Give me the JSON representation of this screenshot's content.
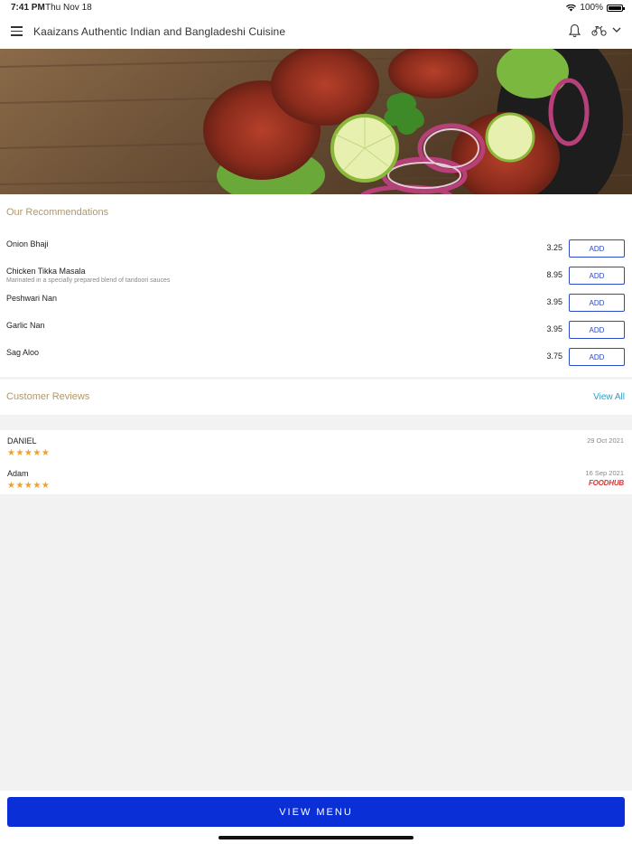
{
  "status_bar": {
    "time": "7:41 PM",
    "date": "Thu Nov 18",
    "battery": "100%"
  },
  "header": {
    "title": "Kaaizans Authentic Indian and Bangladeshi Cuisine"
  },
  "recommendations": {
    "title": "Our Recommendations",
    "items": [
      {
        "name": "Onion Bhaji",
        "description": "",
        "price": "3.25",
        "add_label": "ADD"
      },
      {
        "name": "Chicken Tikka Masala",
        "description": "Marinated in a specially prepared blend of tandoori sauces",
        "price": "8.95",
        "add_label": "ADD"
      },
      {
        "name": "Peshwari Nan",
        "description": "",
        "price": "3.95",
        "add_label": "ADD"
      },
      {
        "name": "Garlic Nan",
        "description": "",
        "price": "3.95",
        "add_label": "ADD"
      },
      {
        "name": "Sag Aloo",
        "description": "",
        "price": "3.75",
        "add_label": "ADD"
      }
    ]
  },
  "reviews": {
    "title": "Customer Reviews",
    "view_all": "View All",
    "items": [
      {
        "name": "DANIEL",
        "date": "29 Oct 2021",
        "stars": "★★★★★",
        "rating": 5,
        "source": ""
      },
      {
        "name": "Adam",
        "date": "16 Sep 2021",
        "stars": "★★★★★",
        "rating": 5,
        "source": "FOODHUB"
      }
    ]
  },
  "footer": {
    "view_menu": "VIEW MENU"
  },
  "colors": {
    "accent": "#0a2fd6",
    "section_title": "#b0976b",
    "link": "#2a9fc2",
    "star": "#f0a030"
  }
}
